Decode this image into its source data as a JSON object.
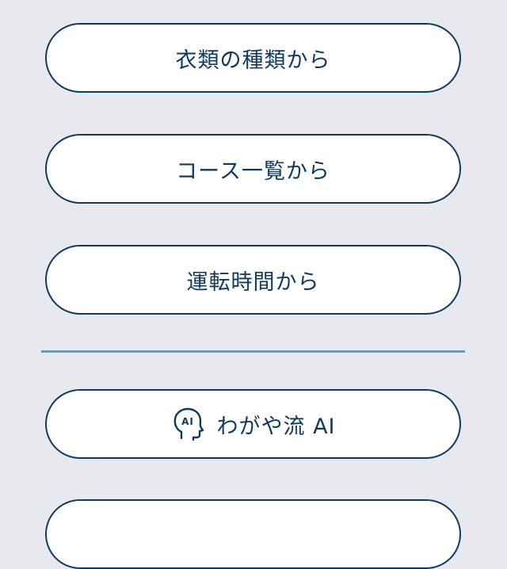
{
  "menu": {
    "items": [
      {
        "label": "衣類の種類から"
      },
      {
        "label": "コース一覧から"
      },
      {
        "label": "運転時間から"
      }
    ],
    "ai": {
      "label": "わがや流 AI",
      "icon": "head-ai-icon",
      "icon_text": "AI"
    }
  },
  "colors": {
    "background": "#e8e9ee",
    "accent": "#0f3a5c",
    "divider": "#6f9ab6",
    "button_fill": "#ffffff"
  }
}
